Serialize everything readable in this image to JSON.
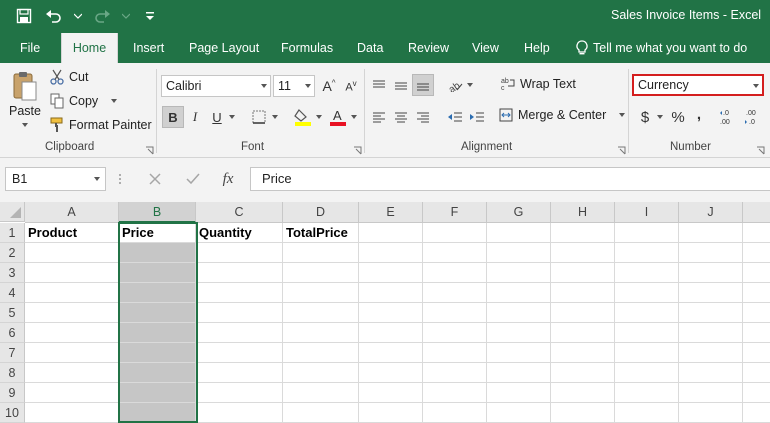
{
  "title": "Sales Invoice Items - Excel",
  "qat": {
    "icons": [
      "save-icon",
      "undo-icon",
      "redo-icon",
      "customize-icon"
    ]
  },
  "tabs": [
    "File",
    "Home",
    "Insert",
    "Page Layout",
    "Formulas",
    "Data",
    "Review",
    "View",
    "Help"
  ],
  "active_tab": "Home",
  "tell_me": "Tell me what you want to do",
  "clipboard": {
    "paste": "Paste",
    "cut": "Cut",
    "copy": "Copy",
    "format_painter": "Format Painter",
    "label": "Clipboard"
  },
  "font": {
    "name": "Calibri",
    "size": "11",
    "bold": "B",
    "italic": "I",
    "underline": "U",
    "label": "Font"
  },
  "alignment": {
    "wrap_text": "Wrap Text",
    "merge_center": "Merge & Center",
    "label": "Alignment"
  },
  "number": {
    "format": "Currency",
    "currency_symbol": "$",
    "percent": "%",
    "comma": ",",
    "label": "Number"
  },
  "formula_bar": {
    "name_box": "B1",
    "fx": "fx",
    "content": "Price"
  },
  "colors": {
    "accent": "#217346",
    "highlight_box": "#d41e1e",
    "selection_fill": "#c6c6c6",
    "fill_color_bar": "#ffff00",
    "font_color_bar": "#e81123"
  },
  "columns": [
    "A",
    "B",
    "C",
    "D",
    "E",
    "F",
    "G",
    "H",
    "I",
    "J"
  ],
  "selected_column": "B",
  "rows": [
    "1",
    "2",
    "3",
    "4",
    "5",
    "6",
    "7",
    "8",
    "9",
    "10"
  ],
  "cells": {
    "A1": "Product",
    "B1": "Price",
    "C1": "Quantity",
    "D1": "TotalPrice"
  }
}
